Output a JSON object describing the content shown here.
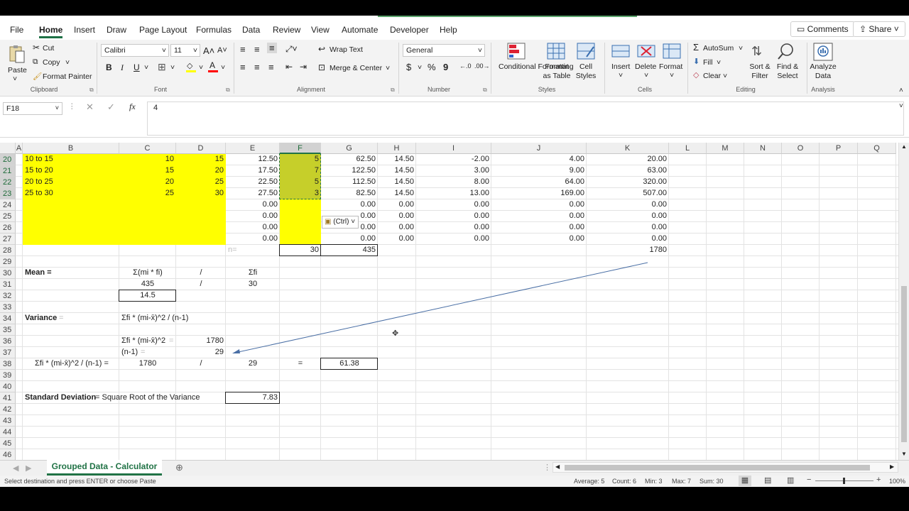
{
  "menu": {
    "tabs": [
      "File",
      "Home",
      "Insert",
      "Draw",
      "Page Layout",
      "Formulas",
      "Data",
      "Review",
      "View",
      "Automate",
      "Developer",
      "Help"
    ],
    "comments": "Comments",
    "share": "Share"
  },
  "ribbon": {
    "paste": "Paste",
    "cut": "Cut",
    "copy": "Copy",
    "format_painter": "Format Painter",
    "clipboard": "Clipboard",
    "font_name": "Calibri",
    "font_size": "11",
    "font": "Font",
    "wrap_text": "Wrap Text",
    "merge_center": "Merge & Center",
    "alignment": "Alignment",
    "number_format": "General",
    "number": "Number",
    "conditional_formatting": "Conditional Formatting",
    "format_as_table": "Format as Table",
    "cell_styles": "Cell Styles",
    "styles": "Styles",
    "insert": "Insert",
    "delete": "Delete",
    "format": "Format",
    "cells": "Cells",
    "autosum": "AutoSum",
    "fill": "Fill",
    "clear": "Clear",
    "sort_filter": "Sort & Filter",
    "find_select": "Find & Select",
    "editing": "Editing",
    "analyze_data": "Analyze Data",
    "analysis": "Analysis"
  },
  "formula_bar": {
    "name_box": "F18",
    "value": "4"
  },
  "columns": [
    "A",
    "B",
    "C",
    "D",
    "E",
    "F",
    "G",
    "H",
    "I",
    "J",
    "K",
    "L",
    "M",
    "N",
    "O",
    "P",
    "Q"
  ],
  "rows": [
    "20",
    "21",
    "22",
    "23",
    "24",
    "25",
    "26",
    "27",
    "28",
    "29",
    "30",
    "31",
    "32",
    "33",
    "34",
    "35",
    "36",
    "37",
    "38",
    "39",
    "40",
    "41",
    "42",
    "43",
    "44",
    "45",
    "46"
  ],
  "cells": {
    "B20": "10 to 15",
    "C20": "10",
    "D20": "15",
    "E20": "12.50",
    "F20": "5",
    "G20": "62.50",
    "H20": "14.50",
    "I20": "-2.00",
    "J20": "4.00",
    "K20": "20.00",
    "B21": "15 to 20",
    "C21": "15",
    "D21": "20",
    "E21": "17.50",
    "F21": "7",
    "G21": "122.50",
    "H21": "14.50",
    "I21": "3.00",
    "J21": "9.00",
    "K21": "63.00",
    "B22": "20 to 25",
    "C22": "20",
    "D22": "25",
    "E22": "22.50",
    "F22": "5",
    "G22": "112.50",
    "H22": "14.50",
    "I22": "8.00",
    "J22": "64.00",
    "K22": "320.00",
    "B23": "25 to 30",
    "C23": "25",
    "D23": "30",
    "E23": "27.50",
    "F23": "3",
    "G23": "82.50",
    "H23": "14.50",
    "I23": "13.00",
    "J23": "169.00",
    "K23": "507.00",
    "E24": "0.00",
    "G24": "0.00",
    "H24": "0.00",
    "I24": "0.00",
    "J24": "0.00",
    "K24": "0.00",
    "E25": "0.00",
    "G25": "0.00",
    "H25": "0.00",
    "I25": "0.00",
    "J25": "0.00",
    "K25": "0.00",
    "E26": "0.00",
    "G26": "0.00",
    "H26": "0.00",
    "I26": "0.00",
    "J26": "0.00",
    "K26": "0.00",
    "E27": "0.00",
    "G27": "0.00",
    "H27": "0.00",
    "I27": "0.00",
    "J27": "0.00",
    "K27": "0.00",
    "E28": "n=",
    "F28": "30",
    "G28": "435",
    "K28": "1780",
    "B30": "Mean =",
    "C30": "Σ(mi * fi)",
    "D30": "/",
    "E30": "Σfi",
    "C31": "435",
    "D31": "/",
    "E31": "30",
    "C32": "14.5",
    "B34": "Variance",
    "B34b": "=",
    "C34": "Σfi * (mi-x̄)^2 / (n-1)",
    "C36": "Σfi * (mi-x̄)^2",
    "C36b": "=",
    "D36": "1780",
    "C37": "(n-1)",
    "C37b": "=",
    "D37": "29",
    "B38": "Σfi * (mi-x̄)^2 / (n-1) =",
    "C38": "1780",
    "D38": "/",
    "E38": "29",
    "F38": "=",
    "G38": "61.38",
    "B41": "Standard Deviation",
    "B41b": "= Square Root of the Variance",
    "E41": "7.83"
  },
  "paste_options": "(Ctrl)",
  "sheet_tab": "Grouped Data - Calculator",
  "status": {
    "message": "Select destination and press ENTER or choose Paste",
    "average": "Average: 5",
    "count": "Count: 6",
    "min": "Min: 3",
    "max": "Max: 7",
    "sum": "Sum: 30",
    "zoom": "100%"
  },
  "colors": {
    "excel_green": "#217346",
    "yellow": "#ffff00",
    "selection": "#c6cf2a",
    "arrow": "#4a6fa5"
  }
}
